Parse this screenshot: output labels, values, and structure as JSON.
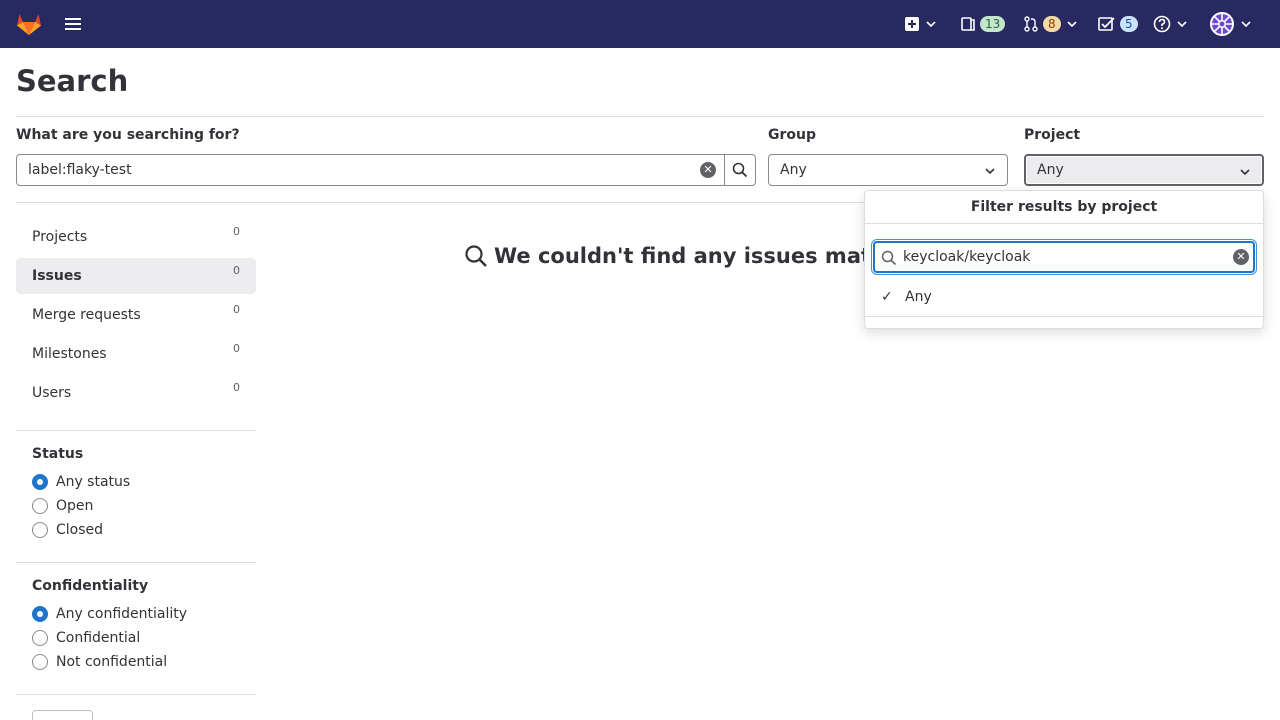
{
  "navbar": {
    "issues_count": "13",
    "merge_requests_count": "8",
    "todos_count": "5"
  },
  "page": {
    "title": "Search"
  },
  "search": {
    "label": "What are you searching for?",
    "value": "label:flaky-test"
  },
  "group": {
    "label": "Group",
    "value": "Any"
  },
  "project": {
    "label": "Project",
    "value": "Any"
  },
  "sidebar": {
    "items": [
      {
        "label": "Projects",
        "count": "0"
      },
      {
        "label": "Issues",
        "count": "0"
      },
      {
        "label": "Merge requests",
        "count": "0"
      },
      {
        "label": "Milestones",
        "count": "0"
      },
      {
        "label": "Users",
        "count": "0"
      }
    ],
    "status": {
      "heading": "Status",
      "options": [
        "Any status",
        "Open",
        "Closed"
      ]
    },
    "confidentiality": {
      "heading": "Confidentiality",
      "options": [
        "Any confidentiality",
        "Confidential",
        "Not confidential"
      ]
    }
  },
  "empty_state": {
    "message": "We couldn't find any issues matching"
  },
  "project_dropdown": {
    "header": "Filter results by project",
    "search_value": "keycloak/keycloak",
    "items": [
      {
        "label": "Any",
        "selected": true
      }
    ]
  },
  "colors": {
    "navbar": "#292961",
    "accent": "#1f75cb"
  }
}
